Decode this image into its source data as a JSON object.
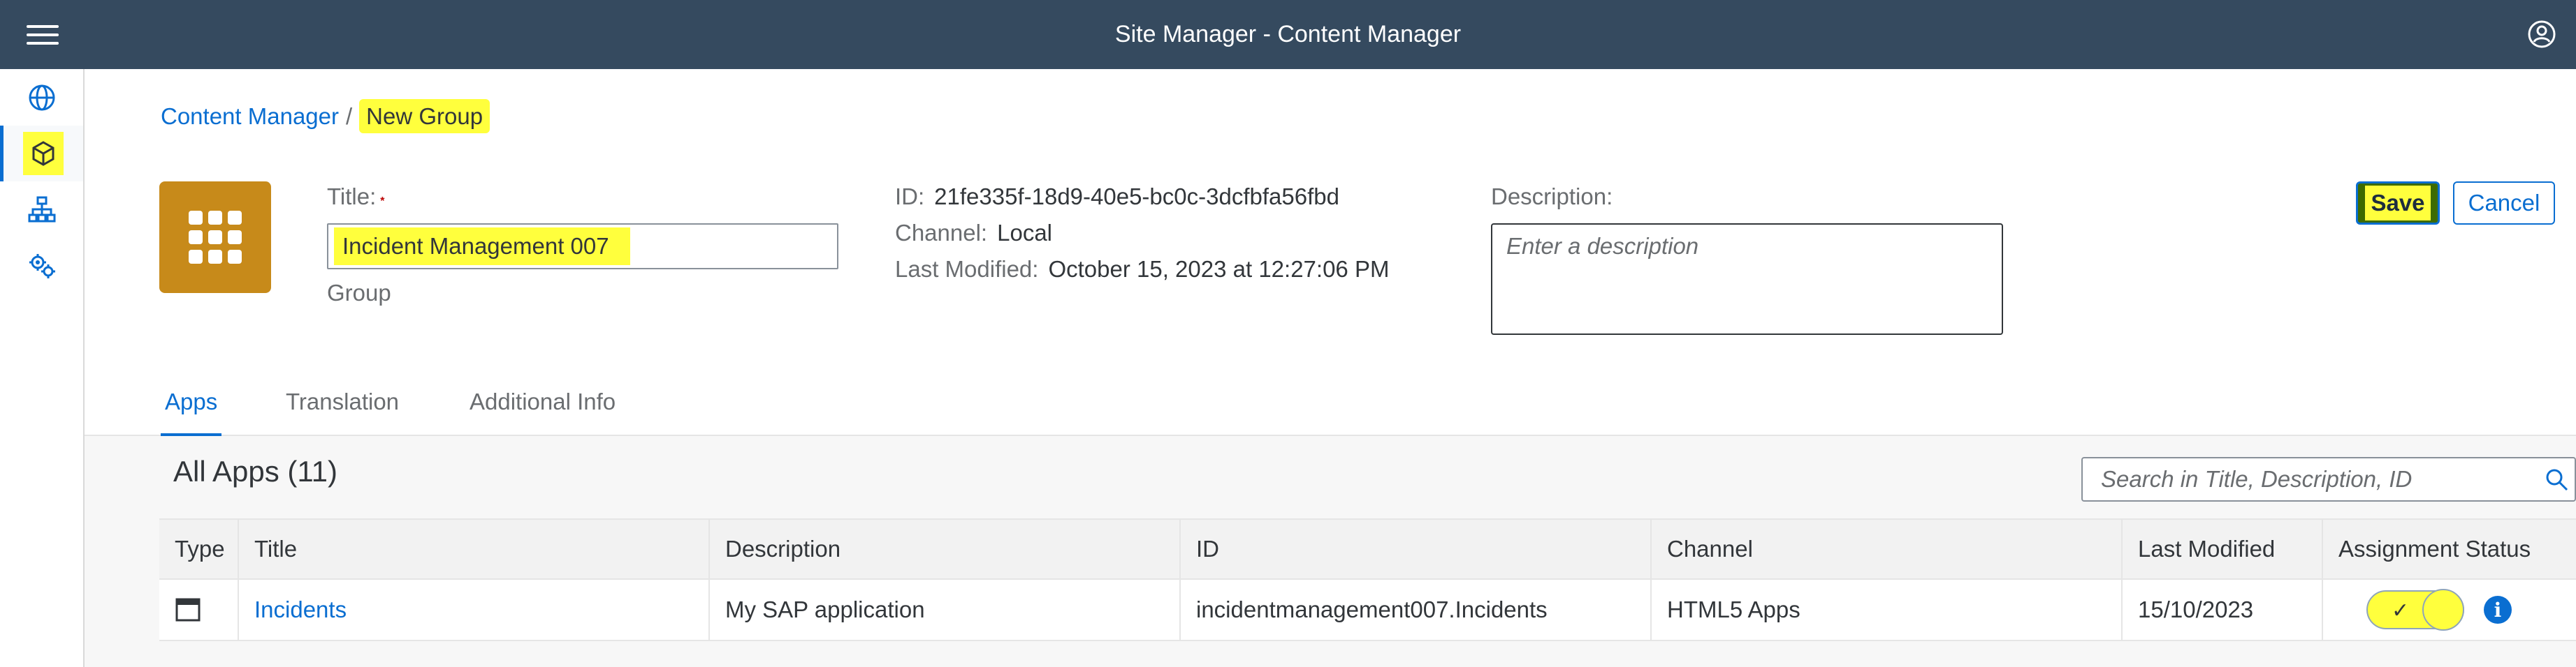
{
  "shell": {
    "title": "Site Manager - Content Manager",
    "icons": [
      "menu-icon",
      "user-profile-icon"
    ]
  },
  "sidenav": {
    "items": [
      {
        "icon": "globe-icon",
        "active": false
      },
      {
        "icon": "cube-icon",
        "active": true
      },
      {
        "icon": "hierarchy-icon",
        "active": false
      },
      {
        "icon": "settings-gears-icon",
        "active": false
      }
    ]
  },
  "breadcrumb": {
    "parent": "Content Manager",
    "separator": "/",
    "current": "New Group"
  },
  "header": {
    "tile_icon": "app-grid-icon",
    "title_label": "Title:",
    "required_mark": "*",
    "title_value": "Incident Management 007",
    "type_label": "Group",
    "id_label": "ID:",
    "id_value": "21fe335f-18d9-40e5-bc0c-3dcfbfa56fbd",
    "channel_label": "Channel:",
    "channel_value": "Local",
    "modified_label": "Last Modified:",
    "modified_value": "October 15, 2023 at 12:27:06 PM",
    "description_label": "Description:",
    "description_placeholder": "Enter a description",
    "save_label": "Save",
    "cancel_label": "Cancel"
  },
  "tabs": [
    {
      "label": "Apps",
      "selected": true
    },
    {
      "label": "Translation",
      "selected": false
    },
    {
      "label": "Additional Info",
      "selected": false
    }
  ],
  "apps_table": {
    "title": "All Apps (11)",
    "search_placeholder": "Search in Title, Description, ID",
    "columns": [
      "Type",
      "Title",
      "Description",
      "ID",
      "Channel",
      "Last Modified",
      "Assignment Status"
    ],
    "rows": [
      {
        "type_icon": "window-icon",
        "title": "Incidents",
        "description": "My SAP application",
        "id": "incidentmanagement007.Incidents",
        "channel": "HTML5 Apps",
        "last_modified": "15/10/2023",
        "assigned": true,
        "toggle_mark": "✓",
        "info_mark": "i"
      }
    ]
  },
  "colors": {
    "shell_bg": "#354a5f",
    "accent": "#0a6ed1",
    "tile_bg": "#c78a1a",
    "highlight": "#ffff3d"
  }
}
